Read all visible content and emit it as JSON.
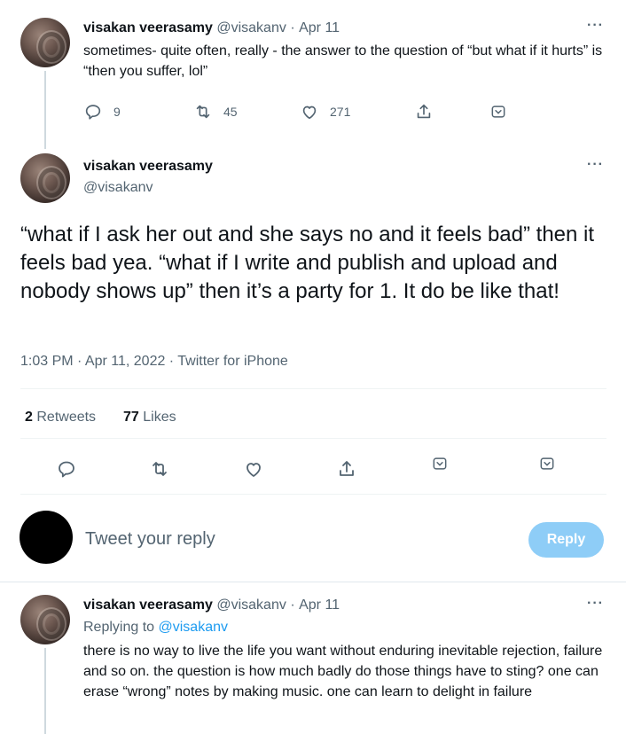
{
  "tweet1": {
    "name": "visakan veerasamy",
    "handle": "@visakanv",
    "sep": "·",
    "date": "Apr 11",
    "more": "···",
    "text": "sometimes- quite often, really - the answer to the question of “but what if it hurts” is “then you suffer, lol”",
    "replies": "9",
    "retweets": "45",
    "likes": "271"
  },
  "main_tweet": {
    "name": "visakan veerasamy",
    "handle": "@visakanv",
    "more": "···",
    "text": "“what if I ask her out and she says no and it feels bad” then it feels bad yea. “what if I write and publish and upload and nobody shows up” then it’s a party for 1. It do be like that!",
    "timestamp": "1:03 PM · Apr 11, 2022 · Twitter for iPhone",
    "retweets_count": "2",
    "retweets_label": "Retweets",
    "likes_count": "77",
    "likes_label": "Likes"
  },
  "compose": {
    "placeholder": "Tweet your reply",
    "button": "Reply"
  },
  "reply_tweet": {
    "name": "visakan veerasamy",
    "handle": "@visakanv",
    "sep": "·",
    "date": "Apr 11",
    "more": "···",
    "replying_prefix": "Replying to",
    "replying_handle": "@visakanv",
    "text": "there is no way to live the life you want without enduring inevitable rejection, failure and so on. the question is how much badly do those things have to sting? one can erase “wrong” notes by making music. one can learn to delight in failure"
  },
  "colors": {
    "accent": "#1d9bf0",
    "reply_button": "#8ecdf7",
    "secondary_text": "#536471",
    "divider": "#eff3f4"
  },
  "icons": [
    "reply-icon",
    "retweet-icon",
    "like-icon",
    "share-icon",
    "tip-icon",
    "more-icon"
  ]
}
